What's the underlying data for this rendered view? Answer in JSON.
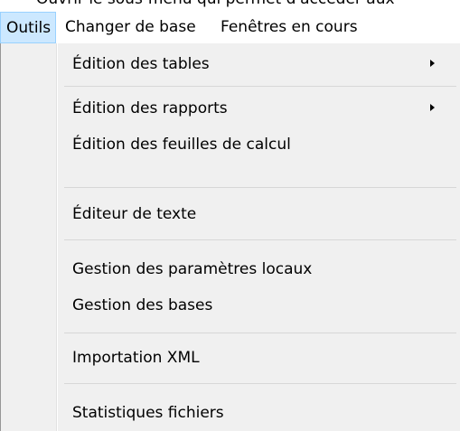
{
  "top_strip_text": "Ouvrir le sous-menu qui permet d'accéder aux",
  "menubar": {
    "items": [
      {
        "label": "Outils",
        "active": true
      },
      {
        "label": "Changer de base"
      },
      {
        "label": "Fenêtres en cours"
      }
    ]
  },
  "dropdown": {
    "items": [
      {
        "label": "Édition des tables",
        "submenu": true
      },
      {
        "label": "Édition des rapports",
        "submenu": true
      },
      {
        "label": "Édition des feuilles de calcul"
      },
      {
        "label": "Éditeur de texte"
      },
      {
        "label": "Gestion des paramètres locaux"
      },
      {
        "label": "Gestion des bases"
      },
      {
        "label": "Importation XML"
      },
      {
        "label": "Statistiques fichiers"
      }
    ]
  }
}
